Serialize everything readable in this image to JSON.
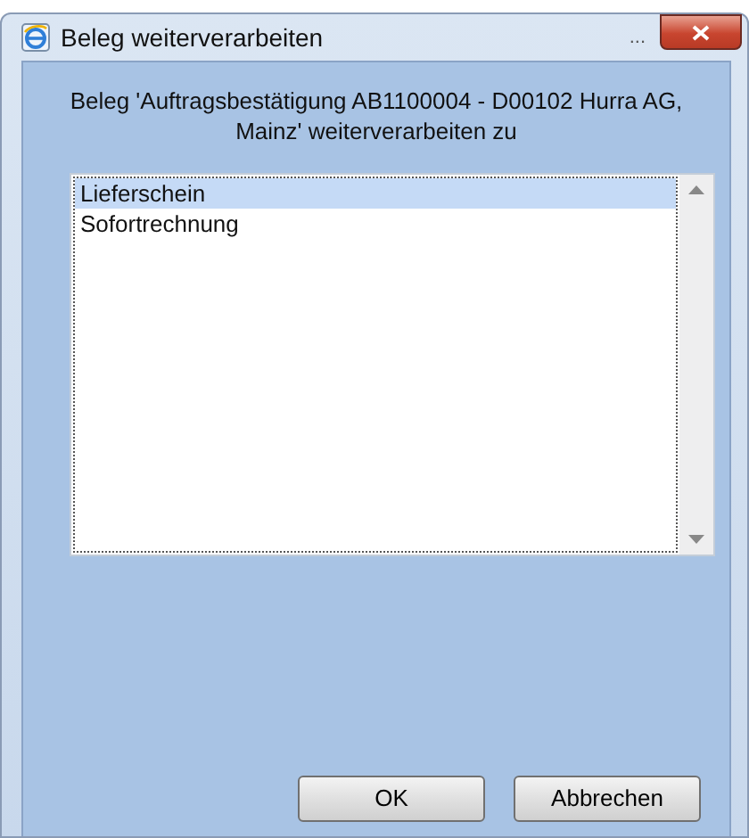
{
  "window": {
    "title": "Beleg weiterverarbeiten",
    "title_overflow": "..."
  },
  "prompt": "Beleg 'Auftragsbestätigung AB1100004 - D00102 Hurra AG, Mainz' weiterverarbeiten zu",
  "options": [
    {
      "label": "Lieferschein",
      "selected": true
    },
    {
      "label": "Sofortrechnung",
      "selected": false
    }
  ],
  "buttons": [
    "OK",
    "Abbrechen"
  ]
}
